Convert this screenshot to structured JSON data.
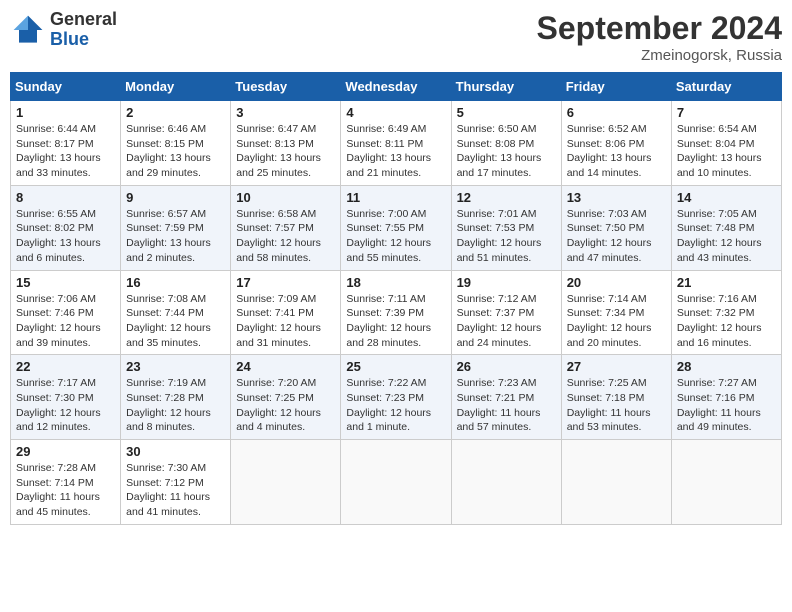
{
  "header": {
    "logo_general": "General",
    "logo_blue": "Blue",
    "month_title": "September 2024",
    "location": "Zmeinogorsk, Russia"
  },
  "days_of_week": [
    "Sunday",
    "Monday",
    "Tuesday",
    "Wednesday",
    "Thursday",
    "Friday",
    "Saturday"
  ],
  "weeks": [
    [
      {
        "day": "1",
        "sunrise": "6:44 AM",
        "sunset": "8:17 PM",
        "daylight": "13 hours and 33 minutes."
      },
      {
        "day": "2",
        "sunrise": "6:46 AM",
        "sunset": "8:15 PM",
        "daylight": "13 hours and 29 minutes."
      },
      {
        "day": "3",
        "sunrise": "6:47 AM",
        "sunset": "8:13 PM",
        "daylight": "13 hours and 25 minutes."
      },
      {
        "day": "4",
        "sunrise": "6:49 AM",
        "sunset": "8:11 PM",
        "daylight": "13 hours and 21 minutes."
      },
      {
        "day": "5",
        "sunrise": "6:50 AM",
        "sunset": "8:08 PM",
        "daylight": "13 hours and 17 minutes."
      },
      {
        "day": "6",
        "sunrise": "6:52 AM",
        "sunset": "8:06 PM",
        "daylight": "13 hours and 14 minutes."
      },
      {
        "day": "7",
        "sunrise": "6:54 AM",
        "sunset": "8:04 PM",
        "daylight": "13 hours and 10 minutes."
      }
    ],
    [
      {
        "day": "8",
        "sunrise": "6:55 AM",
        "sunset": "8:02 PM",
        "daylight": "13 hours and 6 minutes."
      },
      {
        "day": "9",
        "sunrise": "6:57 AM",
        "sunset": "7:59 PM",
        "daylight": "13 hours and 2 minutes."
      },
      {
        "day": "10",
        "sunrise": "6:58 AM",
        "sunset": "7:57 PM",
        "daylight": "12 hours and 58 minutes."
      },
      {
        "day": "11",
        "sunrise": "7:00 AM",
        "sunset": "7:55 PM",
        "daylight": "12 hours and 55 minutes."
      },
      {
        "day": "12",
        "sunrise": "7:01 AM",
        "sunset": "7:53 PM",
        "daylight": "12 hours and 51 minutes."
      },
      {
        "day": "13",
        "sunrise": "7:03 AM",
        "sunset": "7:50 PM",
        "daylight": "12 hours and 47 minutes."
      },
      {
        "day": "14",
        "sunrise": "7:05 AM",
        "sunset": "7:48 PM",
        "daylight": "12 hours and 43 minutes."
      }
    ],
    [
      {
        "day": "15",
        "sunrise": "7:06 AM",
        "sunset": "7:46 PM",
        "daylight": "12 hours and 39 minutes."
      },
      {
        "day": "16",
        "sunrise": "7:08 AM",
        "sunset": "7:44 PM",
        "daylight": "12 hours and 35 minutes."
      },
      {
        "day": "17",
        "sunrise": "7:09 AM",
        "sunset": "7:41 PM",
        "daylight": "12 hours and 31 minutes."
      },
      {
        "day": "18",
        "sunrise": "7:11 AM",
        "sunset": "7:39 PM",
        "daylight": "12 hours and 28 minutes."
      },
      {
        "day": "19",
        "sunrise": "7:12 AM",
        "sunset": "7:37 PM",
        "daylight": "12 hours and 24 minutes."
      },
      {
        "day": "20",
        "sunrise": "7:14 AM",
        "sunset": "7:34 PM",
        "daylight": "12 hours and 20 minutes."
      },
      {
        "day": "21",
        "sunrise": "7:16 AM",
        "sunset": "7:32 PM",
        "daylight": "12 hours and 16 minutes."
      }
    ],
    [
      {
        "day": "22",
        "sunrise": "7:17 AM",
        "sunset": "7:30 PM",
        "daylight": "12 hours and 12 minutes."
      },
      {
        "day": "23",
        "sunrise": "7:19 AM",
        "sunset": "7:28 PM",
        "daylight": "12 hours and 8 minutes."
      },
      {
        "day": "24",
        "sunrise": "7:20 AM",
        "sunset": "7:25 PM",
        "daylight": "12 hours and 4 minutes."
      },
      {
        "day": "25",
        "sunrise": "7:22 AM",
        "sunset": "7:23 PM",
        "daylight": "12 hours and 1 minute."
      },
      {
        "day": "26",
        "sunrise": "7:23 AM",
        "sunset": "7:21 PM",
        "daylight": "11 hours and 57 minutes."
      },
      {
        "day": "27",
        "sunrise": "7:25 AM",
        "sunset": "7:18 PM",
        "daylight": "11 hours and 53 minutes."
      },
      {
        "day": "28",
        "sunrise": "7:27 AM",
        "sunset": "7:16 PM",
        "daylight": "11 hours and 49 minutes."
      }
    ],
    [
      {
        "day": "29",
        "sunrise": "7:28 AM",
        "sunset": "7:14 PM",
        "daylight": "11 hours and 45 minutes."
      },
      {
        "day": "30",
        "sunrise": "7:30 AM",
        "sunset": "7:12 PM",
        "daylight": "11 hours and 41 minutes."
      },
      null,
      null,
      null,
      null,
      null
    ]
  ]
}
